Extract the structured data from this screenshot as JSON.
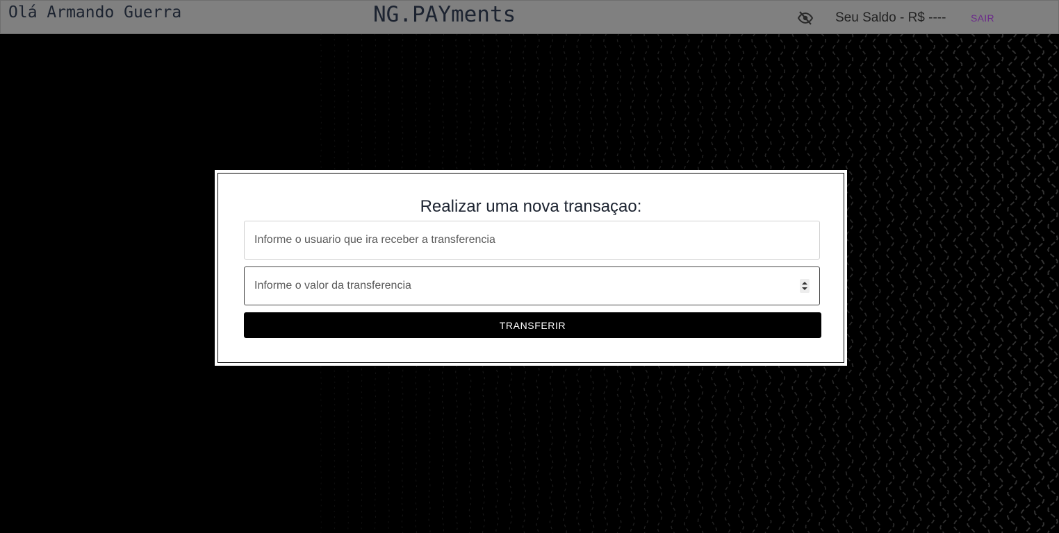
{
  "header": {
    "greeting": "Olá Armando Guerra",
    "brand": "NG.PAYments",
    "visibility_icon": "eye-off-icon",
    "balance_label": "Seu Saldo - R$ ----",
    "logout_label": "SAIR"
  },
  "modal": {
    "title": "Realizar uma nova transaçao:",
    "user_input": {
      "placeholder": "Informe o usuario que ira receber a transferencia",
      "value": ""
    },
    "amount_input": {
      "placeholder": "Informe o valor da transferencia",
      "value": ""
    },
    "submit_label": "TRANSFERIR"
  },
  "colors": {
    "header_bg": "#808080",
    "page_bg": "#000000",
    "logout_accent": "#6b2a8a",
    "button_bg": "#000000",
    "pattern_stroke": "#3a3a3a"
  }
}
